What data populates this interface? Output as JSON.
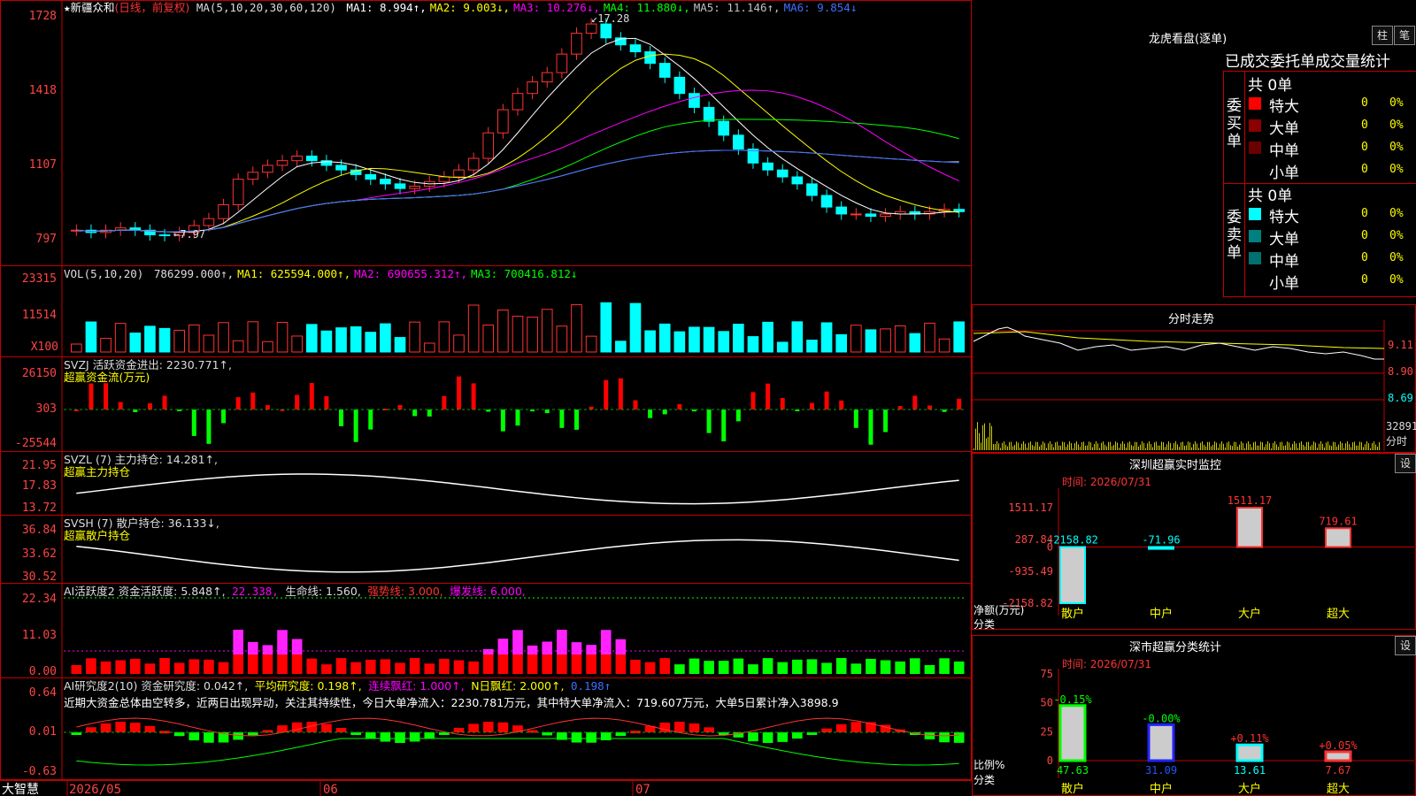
{
  "chart_title": {
    "star": "★",
    "stock_name": "新疆众和",
    "period": "(日线，前复权)",
    "ma_header": "MA(5,10,20,30,60,120)",
    "ma_items": [
      {
        "label": "MA1: 8.994",
        "arrow": "↑",
        "color": "#ffffff"
      },
      {
        "label": "MA2: 9.003",
        "arrow": "↓",
        "color": "#ffff00"
      },
      {
        "label": "MA3: 10.276",
        "arrow": "↓",
        "color": "#ff00ff"
      },
      {
        "label": "MA4: 11.880",
        "arrow": "↓",
        "color": "#00ff00"
      },
      {
        "label": "MA5: 11.146",
        "arrow": "↑",
        "color": "#c0c0c0"
      },
      {
        "label": "MA6: 9.854",
        "arrow": "↓",
        "color": "#3f6fff"
      }
    ],
    "high_mark": "17.28",
    "low_mark": "7.97"
  },
  "price_axis": [
    "1728",
    "1418",
    "1107",
    "797"
  ],
  "vol_panel": {
    "header": "VOL(5,10,20)",
    "items": [
      {
        "label": "786299.000",
        "arrow": "↑",
        "color": "#dddddd"
      },
      {
        "label": "MA1: 625594.000",
        "arrow": "↑",
        "color": "#ffff00"
      },
      {
        "label": "MA2: 690655.312",
        "arrow": "↑",
        "color": "#ff00ff"
      },
      {
        "label": "MA3: 700416.812",
        "arrow": "↓",
        "color": "#00ff00"
      }
    ],
    "axis": [
      "23315",
      "11514",
      "X100"
    ]
  },
  "svzj_panel": {
    "header": "SVZJ  活跃资金进出: 2230.771↑,",
    "subtitle": "超赢资金流(万元)",
    "axis": [
      "26150",
      "303",
      "-25544"
    ]
  },
  "svzl_panel": {
    "header": "SVZL (7) 主力持仓: 14.281↑,",
    "subtitle": "超赢主力持仓",
    "axis": [
      "21.95",
      "17.83",
      "13.72"
    ]
  },
  "svsh_panel": {
    "header": "SVSH (7) 散户持仓: 36.133↓,",
    "subtitle": "超赢散户持仓",
    "axis": [
      "36.84",
      "33.62",
      "30.52"
    ]
  },
  "ai2_panel": {
    "header": "AI活跃度2 资金活跃度: 5.848↑,",
    "v2": "22.338,",
    "v3": "生命线: 1.560,",
    "v4": "强势线: 3.000,",
    "v5": "爆发线: 6.000,",
    "axis": [
      "22.34",
      "11.03",
      "0.00"
    ]
  },
  "ai_res_panel": {
    "header": "AI研究度2(10) 资金研究度: 0.042↑,",
    "v2": "平均研究度: 0.198↑,",
    "v3": "连续飘红: 1.000↑,",
    "v4": "N日飘红: 2.000↑,",
    "v5": "0.198↑",
    "comment": "近期大资金总体由空转多，近两日出现异动，关注其持续性，今日大单净流入：2230.781万元，其中特大单净流入：719.607万元，大单5日累计净入3898.9",
    "axis": [
      "0.64",
      "0.01",
      "-0.63"
    ]
  },
  "date_axis": {
    "brand": "大智慧",
    "labels": [
      "2026/05",
      "06",
      "07"
    ]
  },
  "right_panel": {
    "longhu_title": "龙虎看盘(逐单)",
    "btn_zhu": "柱",
    "btn_bi": "笔",
    "stats_title": "已成交委托单成交量统计",
    "buy_group_label": "委买单",
    "sell_group_label": "委卖单",
    "buy_total": "共 0单",
    "sell_total": "共 0单",
    "buy_rows": [
      {
        "name": "特大",
        "count": "0",
        "pct": "0%",
        "color": "#ff0000"
      },
      {
        "name": "大单",
        "count": "0",
        "pct": "0%",
        "color": "#8b0000"
      },
      {
        "name": "中单",
        "count": "0",
        "pct": "0%",
        "color": "#6b0000"
      },
      {
        "name": "小单",
        "count": "0",
        "pct": "0%",
        "color": ""
      }
    ],
    "sell_rows": [
      {
        "name": "特大",
        "count": "0",
        "pct": "0%",
        "color": "#00ffff"
      },
      {
        "name": "大单",
        "count": "0",
        "pct": "0%",
        "color": "#008080"
      },
      {
        "name": "中单",
        "count": "0",
        "pct": "0%",
        "color": "#007070"
      },
      {
        "name": "小单",
        "count": "0",
        "pct": "0%",
        "color": ""
      }
    ],
    "intraday_title": "分时走势",
    "intraday_axis": [
      "9.11",
      "8.90",
      "8.69",
      "32891",
      "分时"
    ],
    "monitor_title": "深圳超赢实时监控",
    "monitor_time": "时间: 2026/07/31",
    "monitor_axis": [
      "1511.17",
      "287.84",
      "0",
      "-935.49",
      "-2158.82"
    ],
    "monitor_ylabel": "净额(万元)",
    "monitor_xlabel": "分类",
    "classify_title": "深市超赢分类统计",
    "classify_time": "时间: 2026/07/31",
    "classify_axis": [
      "75",
      "50",
      "25",
      "0"
    ],
    "classify_ylabel": "比例%",
    "classify_xlabel": "分类",
    "btn_set": "设"
  },
  "chart_data": [
    {
      "type": "bar",
      "title": "深圳超赢实时监控",
      "categories": [
        "散户",
        "中户",
        "大户",
        "超大"
      ],
      "values": [
        -2158.82,
        -71.96,
        1511.17,
        719.61
      ],
      "value_labels": [
        "-2158.82",
        "-71.96",
        "1511.17",
        "719.61"
      ],
      "ylabel": "净额(万元)",
      "xlabel": "分类",
      "ylim": [
        -2158.82,
        1511.17
      ]
    },
    {
      "type": "bar",
      "title": "深市超赢分类统计",
      "categories": [
        "散户",
        "中户",
        "大户",
        "超大"
      ],
      "values": [
        47.63,
        31.09,
        13.61,
        7.67
      ],
      "value_labels": [
        "47.63",
        "31.09",
        "13.61",
        "7.67"
      ],
      "change_labels": [
        "-0.15%",
        "-0.00%",
        "+0.11%",
        "+0.05%"
      ],
      "ylabel": "比例%",
      "xlabel": "分类",
      "ylim": [
        0,
        75
      ]
    }
  ],
  "colors": {
    "up": "#ff3333",
    "down": "#00ffff",
    "border": "#c00000",
    "axis_text": "#ff4444",
    "yellow": "#ffff00"
  }
}
